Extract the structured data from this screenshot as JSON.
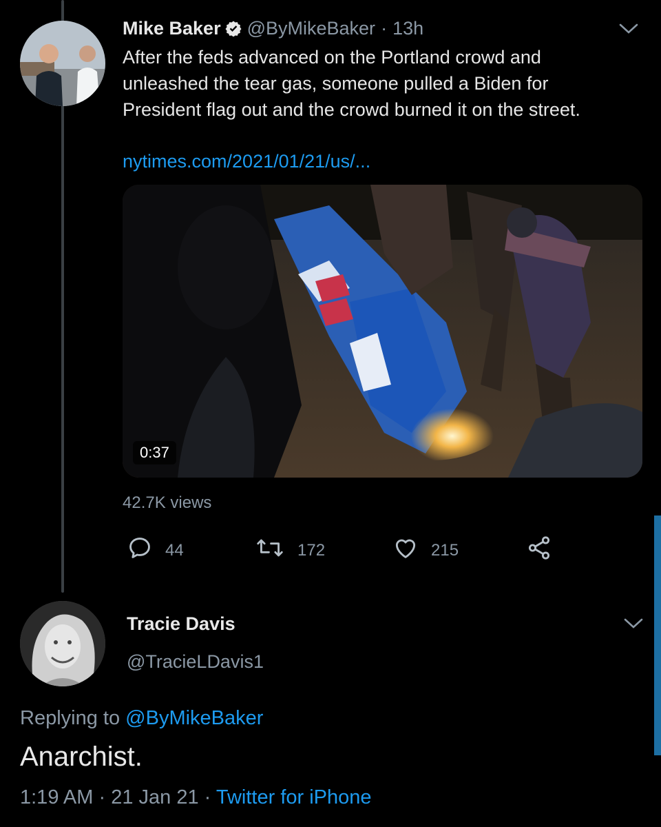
{
  "tweet": {
    "author_name": "Mike Baker",
    "author_handle": "@ByMikeBaker",
    "separator": "·",
    "time_ago": "13h",
    "text_lines": [
      "After the feds advanced on the Portland crowd and",
      "unleashed the tear gas, someone pulled a Biden for",
      "President flag out and the crowd burned it on the street."
    ],
    "link": "nytimes.com/2021/01/21/us/...",
    "video_duration": "0:37",
    "views": "42.7K views",
    "actions": {
      "replies": "44",
      "retweets": "172",
      "likes": "215"
    },
    "icons": [
      "reply-icon",
      "retweet-icon",
      "like-icon",
      "share-icon",
      "chevron-down-icon",
      "verified-icon"
    ]
  },
  "reply": {
    "author_name": "Tracie Davis",
    "author_handle": "@TracieLDavis1",
    "replying_prefix": "Replying to",
    "replying_handle": "@ByMikeBaker",
    "text": "Anarchist.",
    "time": "1:19 AM",
    "separator": "·",
    "date": "21 Jan 21",
    "source": "Twitter for iPhone"
  },
  "colors": {
    "background": "#000000",
    "link": "#1d9bf0",
    "secondary_text": "#8b98a5",
    "scrollbar": "#1d6fa3"
  }
}
